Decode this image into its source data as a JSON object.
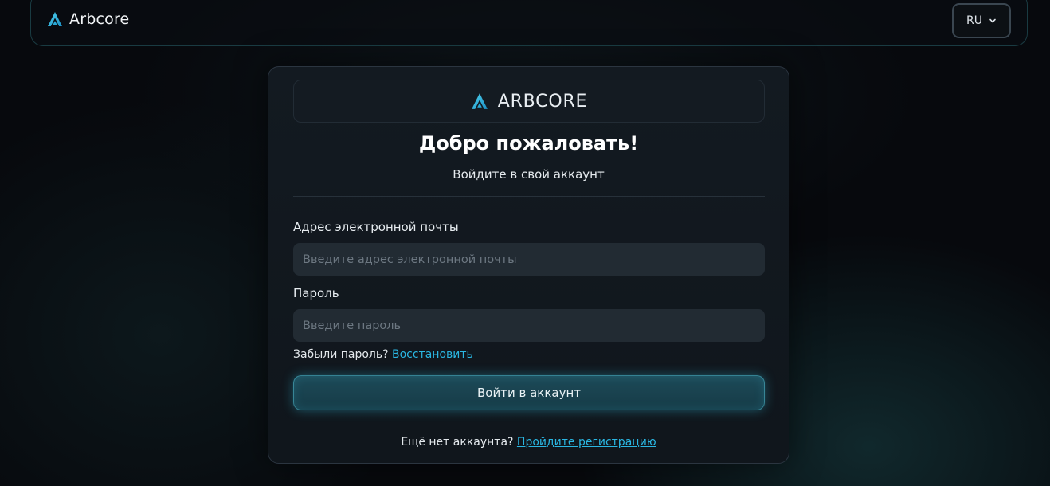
{
  "header": {
    "brand_name": "Arbcore",
    "language": "RU"
  },
  "card": {
    "logo_text": "ARBCORE",
    "title": "Добро пожаловать!",
    "subtitle": "Войдите в свой аккаунт",
    "email": {
      "label": "Адрес электронной почты",
      "value": "",
      "placeholder": "Введите адрес электронной почты"
    },
    "password": {
      "label": "Пароль",
      "value": "",
      "placeholder": "Введите пароль"
    },
    "forgot_text": "Забыли пароль?",
    "forgot_link": "Восстановить",
    "submit_label": "Войти в аккаунт",
    "register_text": "Ещё нет аккаунта?",
    "register_link": "Пройдите регистрацию"
  },
  "colors": {
    "accent": "#2ab6e2",
    "background": "#07090d",
    "card": "#131a21",
    "input": "#222b33"
  },
  "icons": {
    "brand": "arbcore-logo-icon",
    "language_dropdown": "chevron-down-icon"
  }
}
